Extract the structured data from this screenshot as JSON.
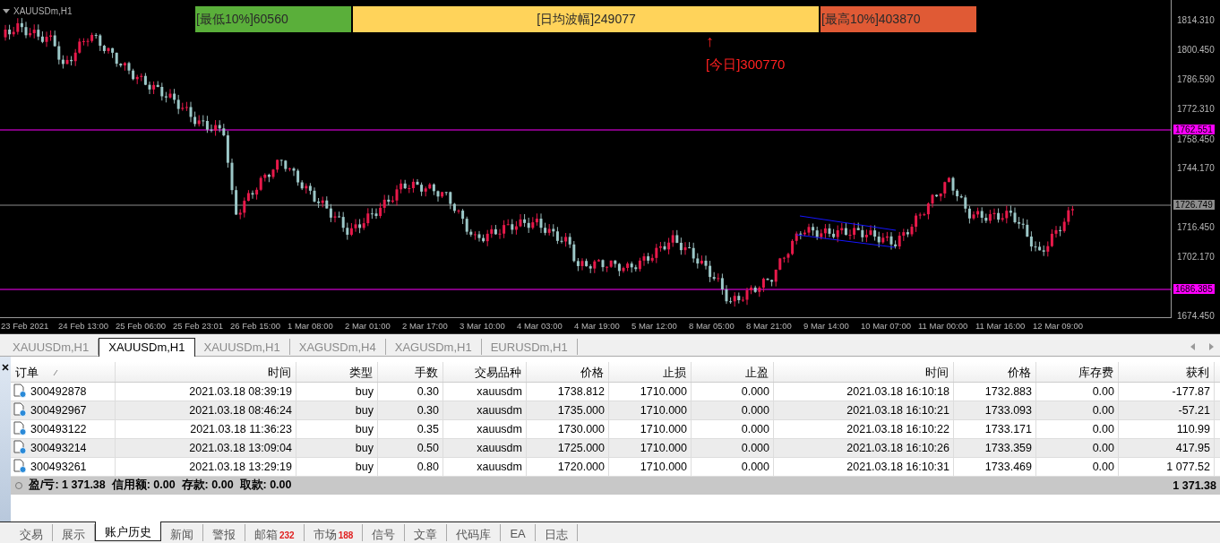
{
  "chart": {
    "title": "XAUUSDm,H1",
    "banners": [
      {
        "label": "[最低10%]60560",
        "color": "#5aaf3a"
      },
      {
        "label": "[日均波幅]249077",
        "color": "#ffd35a"
      },
      {
        "label": "[最高10%]403870",
        "color": "#e05a35"
      }
    ],
    "today": {
      "arrow": "↑",
      "label": "[今日]300770"
    },
    "price_ticks": [
      "1814.310",
      "1800.450",
      "1786.590",
      "1772.310",
      "1758.450",
      "1744.170",
      "1716.450",
      "1702.170",
      "1674.450"
    ],
    "price_lines": [
      {
        "label": "1762.551",
        "color": "#ff00ff"
      },
      {
        "label": "1726.749",
        "color": "#8c8c8c"
      },
      {
        "label": "1686.385",
        "color": "#ff00ff"
      }
    ],
    "time_ticks": [
      "23 Feb 2021",
      "24 Feb 13:00",
      "25 Feb 06:00",
      "25 Feb 23:01",
      "26 Feb 15:00",
      "1 Mar 08:00",
      "2 Mar 01:00",
      "2 Mar 17:00",
      "3 Mar 10:00",
      "4 Mar 03:00",
      "4 Mar 19:00",
      "5 Mar 12:00",
      "8 Mar 05:00",
      "8 Mar 21:00",
      "9 Mar 14:00",
      "10 Mar 07:00",
      "11 Mar 00:00",
      "11 Mar 16:00",
      "12 Mar 09:00"
    ]
  },
  "chart_tabs": [
    {
      "label": "XAUUSDm,H1",
      "selected": false
    },
    {
      "label": "XAUUSDm,H1",
      "selected": true
    },
    {
      "label": "XAUUSDm,H1",
      "selected": false
    },
    {
      "label": "XAGUSDm,H4",
      "selected": false
    },
    {
      "label": "XAGUSDm,H1",
      "selected": false
    },
    {
      "label": "EURUSDm,H1",
      "selected": false
    }
  ],
  "table": {
    "columns": [
      "订单",
      "时间",
      "类型",
      "手数",
      "交易品种",
      "价格",
      "止损",
      "止盈",
      "时间",
      "价格",
      "库存费",
      "获利"
    ],
    "rows": [
      [
        "300492878",
        "2021.03.18 08:39:19",
        "buy",
        "0.30",
        "xauusdm",
        "1738.812",
        "1710.000",
        "0.000",
        "2021.03.18 16:10:18",
        "1732.883",
        "0.00",
        "-177.87"
      ],
      [
        "300492967",
        "2021.03.18 08:46:24",
        "buy",
        "0.30",
        "xauusdm",
        "1735.000",
        "1710.000",
        "0.000",
        "2021.03.18 16:10:21",
        "1733.093",
        "0.00",
        "-57.21"
      ],
      [
        "300493122",
        "2021.03.18 11:36:23",
        "buy",
        "0.35",
        "xauusdm",
        "1730.000",
        "1710.000",
        "0.000",
        "2021.03.18 16:10:22",
        "1733.171",
        "0.00",
        "110.99"
      ],
      [
        "300493214",
        "2021.03.18 13:09:04",
        "buy",
        "0.50",
        "xauusdm",
        "1725.000",
        "1710.000",
        "0.000",
        "2021.03.18 16:10:26",
        "1733.359",
        "0.00",
        "417.95"
      ],
      [
        "300493261",
        "2021.03.18 13:29:19",
        "buy",
        "0.80",
        "xauusdm",
        "1720.000",
        "1710.000",
        "0.000",
        "2021.03.18 16:10:31",
        "1733.469",
        "0.00",
        "1 077.52"
      ]
    ],
    "summary": "盈/亏: 1 371.38  信用额: 0.00  存款: 0.00  取款: 0.00",
    "total": "1 371.38"
  },
  "bottom_tabs": [
    {
      "label": "交易",
      "selected": false
    },
    {
      "label": "展示",
      "selected": false
    },
    {
      "label": "账户历史",
      "selected": true
    },
    {
      "label": "新闻",
      "selected": false
    },
    {
      "label": "警报",
      "selected": false
    },
    {
      "label": "邮箱",
      "badge": "232",
      "selected": false
    },
    {
      "label": "市场",
      "badge": "188",
      "selected": false
    },
    {
      "label": "信号",
      "selected": false
    },
    {
      "label": "文章",
      "selected": false
    },
    {
      "label": "代码库",
      "selected": false
    },
    {
      "label": "EA",
      "selected": false
    },
    {
      "label": "日志",
      "selected": false
    }
  ]
}
